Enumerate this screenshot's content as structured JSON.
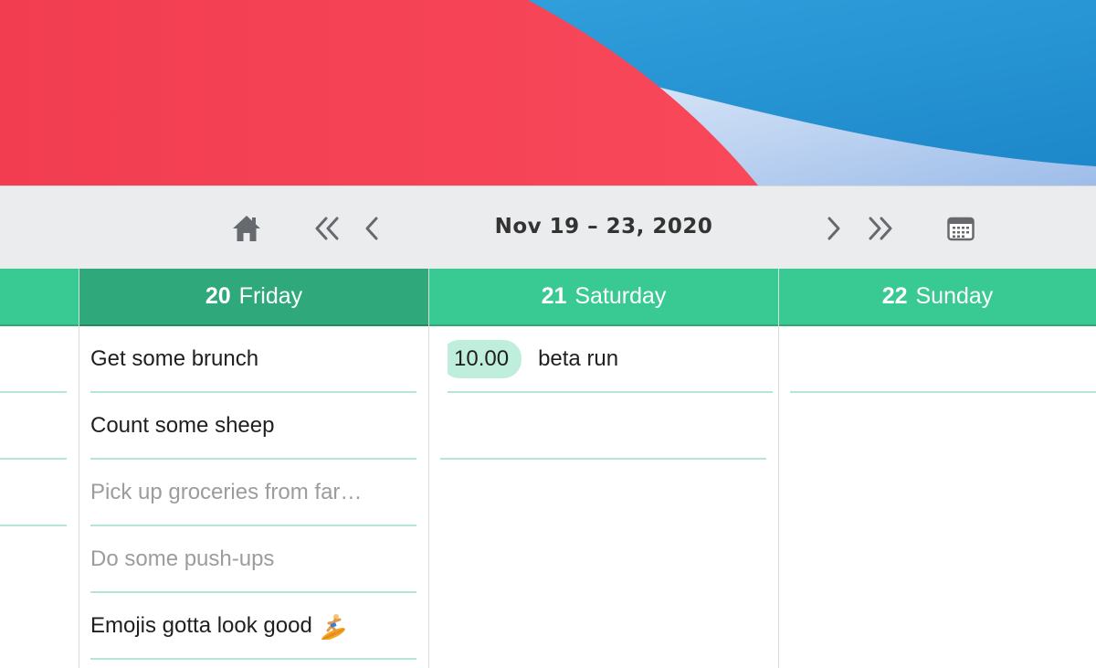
{
  "toolbar": {
    "date_range": "Nov 19 – 23, 2020",
    "icons": {
      "home": "home-icon",
      "jump_back": "double-chevron-left-icon",
      "back": "chevron-left-icon",
      "forward": "chevron-right-icon",
      "jump_forward": "double-chevron-right-icon",
      "calendar": "calendar-icon"
    }
  },
  "days": [
    {
      "number": "20",
      "name": "Friday",
      "active": true,
      "items": [
        {
          "text": "Get some brunch",
          "done": false
        },
        {
          "text": "Count some sheep",
          "done": false
        },
        {
          "text": "Pick up groceries from far…",
          "done": true
        },
        {
          "text": "Do some push-ups",
          "done": true
        },
        {
          "text": "Emojis gotta look good",
          "done": false,
          "emoji": "surfer-emoji"
        }
      ]
    },
    {
      "number": "21",
      "name": "Saturday",
      "active": false,
      "items": [
        {
          "time": "10.00",
          "text": "beta run",
          "done": false
        }
      ]
    },
    {
      "number": "22",
      "name": "Sunday",
      "active": false,
      "items": []
    }
  ],
  "colors": {
    "header_green": "#39c993",
    "header_active_green": "#2fa97c",
    "row_line": "#b3e7d3",
    "time_pill": "#bfeedd",
    "wallpaper_red": "#f44354",
    "wallpaper_blue": "#2294d6"
  }
}
